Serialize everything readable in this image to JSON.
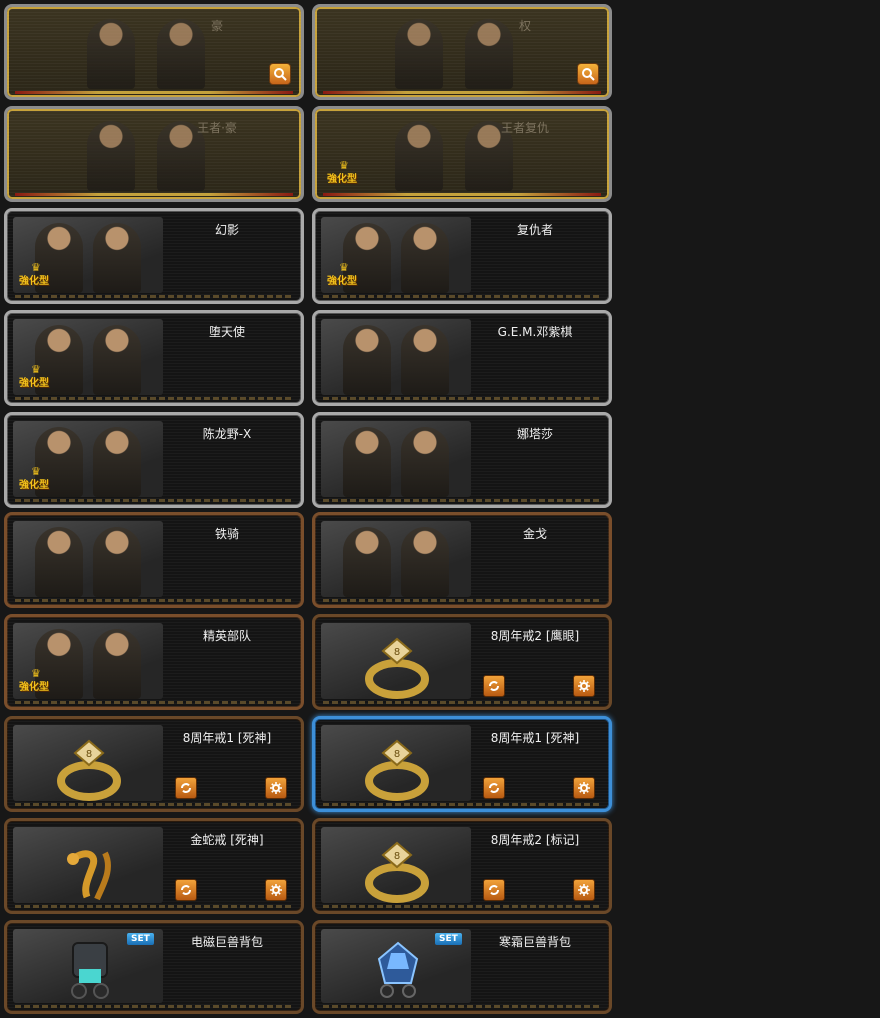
{
  "colors": {
    "accent_gold": "#c7a23a",
    "selection_blue": "#3d8fd8",
    "button_orange": "#f1a23a",
    "text": "#f0f0f0"
  },
  "cards": [
    {
      "title": "豪",
      "theme": "gold",
      "icon": "magnifier-icon"
    },
    {
      "title": "权",
      "theme": "gold",
      "icon": "magnifier-icon"
    },
    {
      "title": "王者·豪",
      "theme": "gold"
    },
    {
      "title": "王者复仇",
      "theme": "gold",
      "badge": "強化型"
    },
    {
      "title": "幻影",
      "theme": "silver",
      "badge": "強化型"
    },
    {
      "title": "复仇者",
      "theme": "silver",
      "badge": "強化型"
    },
    {
      "title": "堕天使",
      "theme": "silver",
      "badge": "強化型"
    },
    {
      "title": "G.E.M.邓紫棋",
      "theme": "silver"
    },
    {
      "title": "陈龙野-X",
      "theme": "silver",
      "badge": "強化型"
    },
    {
      "title": "娜塔莎",
      "theme": "silver"
    },
    {
      "title": "铁骑",
      "theme": "bronze"
    },
    {
      "title": "金戈",
      "theme": "bronze"
    },
    {
      "title": "精英部队",
      "theme": "bronze",
      "badge": "強化型"
    },
    {
      "title": "8周年戒2 [鹰眼]",
      "theme": "item",
      "art": "ring"
    },
    {
      "title": "8周年戒1 [死神]",
      "theme": "item",
      "art": "ring"
    },
    {
      "title": "8周年戒1 [死神]",
      "theme": "item",
      "art": "ring",
      "selected": true
    },
    {
      "title": "金蛇戒 [死神]",
      "theme": "item",
      "art": "snake-ring"
    },
    {
      "title": "8周年戒2 [标记]",
      "theme": "item",
      "art": "ring"
    },
    {
      "title": "电磁巨兽背包",
      "theme": "item",
      "art": "backpack",
      "tag": "SET"
    },
    {
      "title": "寒霜巨兽背包",
      "theme": "item",
      "art": "backpack-frost",
      "tag": "SET"
    }
  ]
}
